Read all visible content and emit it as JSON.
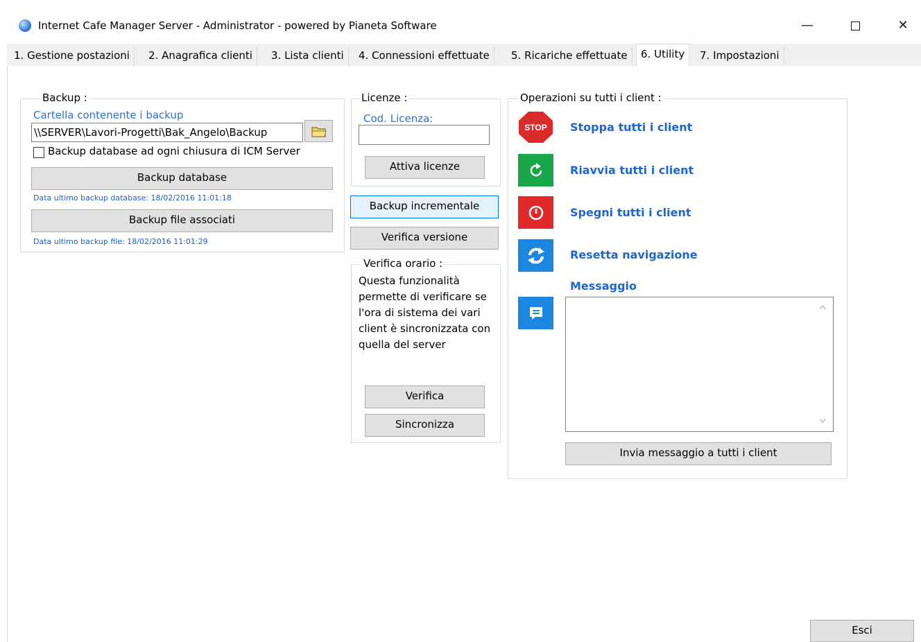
{
  "window": {
    "title": "Internet Cafe Manager Server - Administrator - powered by Pianeta Software",
    "minimize_glyph": "—",
    "close_glyph": "✕"
  },
  "tabs": [
    {
      "label": "1. Gestione postazioni"
    },
    {
      "label": "2. Anagrafica clienti"
    },
    {
      "label": "3. Lista clienti"
    },
    {
      "label": "4. Connessioni effettuate"
    },
    {
      "label": "5. Ricariche effettuate"
    },
    {
      "label": "6. Utility"
    },
    {
      "label": "7. Impostazioni"
    }
  ],
  "active_tab": "6. Utility",
  "backup": {
    "title": "Backup :",
    "folder_label": "Cartella contenente i backup",
    "folder_value": "\\\\SERVER\\Lavori-Progetti\\Bak_Angelo\\Backup",
    "checkbox_label": "Backup database ad ogni chiusura di ICM Server",
    "checkbox_checked": false,
    "db_button": "Backup database",
    "db_last": "Data ultimo backup database: 18/02/2016 11:01:18",
    "files_button": "Backup file associati",
    "files_last": "Data ultimo backup file: 18/02/2016 11:01:29"
  },
  "licenze": {
    "title": "Licenze :",
    "code_label": "Cod. Licenza:",
    "code_value": "",
    "activate_button": "Attiva licenze"
  },
  "incremental_button": "Backup incrementale",
  "verify_version_button": "Verifica versione",
  "verifica_orario": {
    "title": "Verifica orario :",
    "lines": [
      "Questa funzionalità",
      "permette di verificare se",
      "l'ora di sistema dei vari",
      "client è sincronizzata con",
      "quella del server"
    ],
    "verify_button": "Verifica",
    "sync_button": "Sincronizza"
  },
  "operazioni": {
    "title": "Operazioni su tutti i client :",
    "stop_icon_text": "STOP",
    "stop": "Stoppa tutti i client",
    "restart": "Riavvia tutti i client",
    "shutdown": "Spegni tutti i client",
    "reset": "Resetta navigazione",
    "message_label": "Messaggio",
    "message_value": "",
    "send_button": "Invia messaggio a tutti i client"
  },
  "exit_button": "Esci",
  "colors": {
    "stop": "#d92b2b",
    "restart": "#18a84a",
    "shutdown": "#e02a2a",
    "reset": "#1b87e0",
    "message": "#1b87e0",
    "link": "#2c6fd6"
  }
}
